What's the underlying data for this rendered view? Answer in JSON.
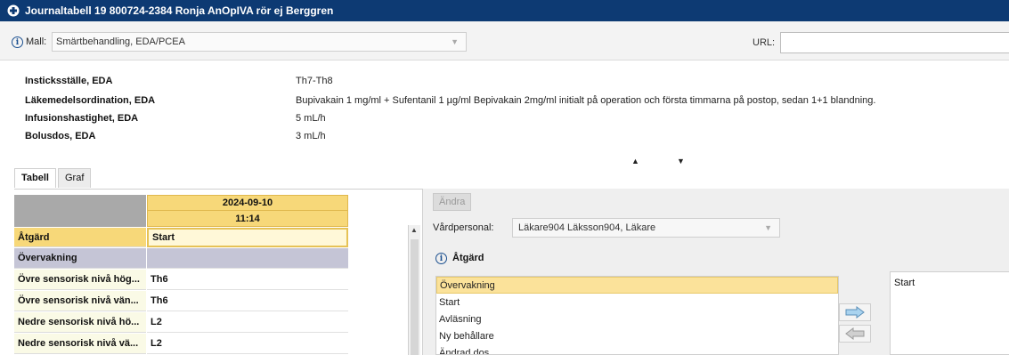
{
  "window": {
    "title": "Journaltabell 19 800724-2384 Ronja AnOpIVA rör ej Berggren",
    "title_bar_color": "#0d3a73"
  },
  "mall": {
    "label": "Mall:",
    "value": "Smärtbehandling, EDA/PCEA"
  },
  "url": {
    "label": "URL:",
    "value": ""
  },
  "info_rows": [
    {
      "key": "Insticksställe, EDA",
      "value": "Th7-Th8"
    },
    {
      "key": "Läkemedelsordination, EDA",
      "value": "Bupivakain 1 mg/ml + Sufentanil 1 µg/ml Bepivakain 2mg/ml initialt på operation och första timmarna på postop, sedan 1+1 blandning."
    },
    {
      "key": "Infusionshastighet, EDA",
      "value": "5 mL/h"
    },
    {
      "key": "Bolusdos, EDA",
      "value": "3 mL/h"
    }
  ],
  "tabs": [
    {
      "label": "Tabell",
      "active": true
    },
    {
      "label": "Graf",
      "active": false
    }
  ],
  "table": {
    "column": {
      "date": "2024-09-10",
      "time": "11:14"
    },
    "rows": [
      {
        "label": "Åtgärd",
        "value": "Start",
        "style": "highlight"
      },
      {
        "label": "Övervakning",
        "value": "",
        "style": "group"
      },
      {
        "label": "Övre sensorisk nivå hög...",
        "value": "Th6",
        "style": "normal"
      },
      {
        "label": "Övre sensorisk nivå vän...",
        "value": "Th6",
        "style": "normal"
      },
      {
        "label": "Nedre sensorisk nivå hö...",
        "value": "L2",
        "style": "normal"
      },
      {
        "label": "Nedre sensorisk nivå vä...",
        "value": "L2",
        "style": "normal"
      }
    ]
  },
  "right": {
    "andra_label": "Ändra",
    "vardpersonal_label": "Vårdpersonal:",
    "vardpersonal_value": "Läkare904 Läksson904, Läkare",
    "atgard_label": "Åtgärd",
    "atgard_items": [
      "Övervakning",
      "Start",
      "Avläsning",
      "Ny behållare",
      "Ändrad dos"
    ],
    "atgard_selected_index": 0,
    "chosen_items": [
      "Start"
    ]
  }
}
